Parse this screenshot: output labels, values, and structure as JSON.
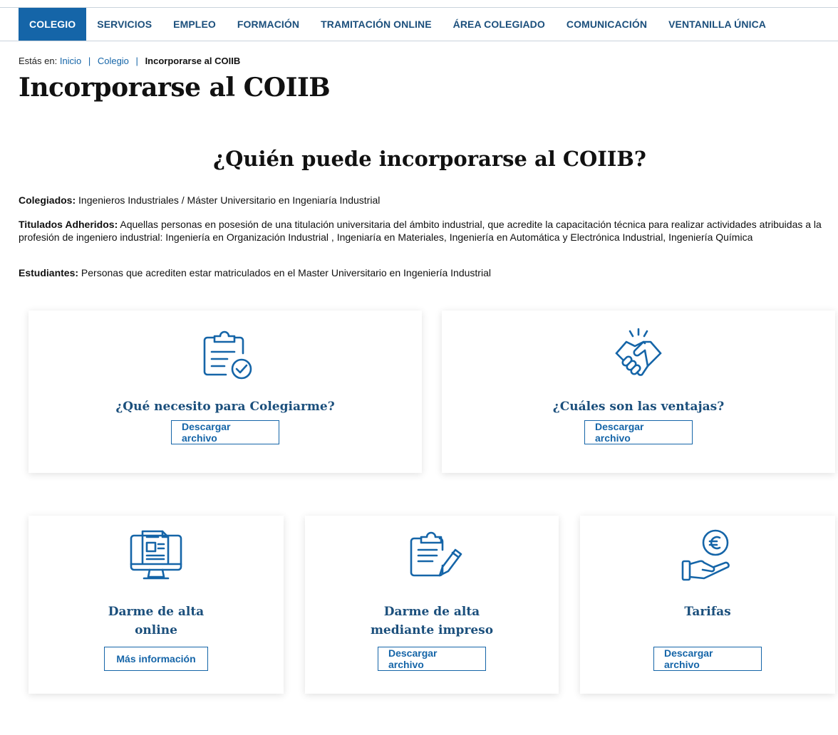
{
  "nav": {
    "items": [
      {
        "label": "COLEGIO"
      },
      {
        "label": "SERVICIOS"
      },
      {
        "label": "EMPLEO"
      },
      {
        "label": "FORMACIÓN"
      },
      {
        "label": "TRAMITACIÓN ONLINE"
      },
      {
        "label": "ÁREA COLEGIADO"
      },
      {
        "label": "COMUNICACIÓN"
      },
      {
        "label": "VENTANILLA ÚNICA"
      }
    ],
    "active": "COLEGIO"
  },
  "breadcrumb": {
    "prefix": "Estás en:",
    "items": [
      "Inicio",
      "Colegio"
    ],
    "separator": "|",
    "current": "Incorporarse al COIIB"
  },
  "page_title": "Incorporarse al COIIB",
  "section_title": "¿Quién puede incorporarse al COIIB?",
  "info": {
    "colegiados_label": "Colegiados:",
    "colegiados_text": " Ingenieros Industriales / Máster Universitario en Ingeniaría Industrial",
    "titulados_label": "Titulados Adheridos:",
    "titulados_text": " Aquellas personas en posesión de una titulación universitaria del ámbito industrial, que acredite la capacitación técnica para realizar actividades atribuidas a la profesión de ingeniero industrial: Ingeniería en Organización Industrial , Ingeniaría en Materiales, Ingeniería en Automática y Electrónica Industrial, Ingeniería Química",
    "estudiantes_label": "Estudiantes:",
    "estudiantes_text": " Personas que acrediten estar matriculados en el Master Universitario en Ingeniería Industrial"
  },
  "cards": [
    {
      "title": "¿Qué necesito para Colegiarme?",
      "button": "Descargar archivo",
      "icon": "clipboard-check-icon"
    },
    {
      "title": "¿Cuáles son las ventajas?",
      "button": "Descargar archivo",
      "icon": "handshake-icon"
    },
    {
      "title_line1": "Darme de alta",
      "title_line2": "online",
      "button": "Más información",
      "icon": "computer-document-icon"
    },
    {
      "title_line1": "Darme de alta",
      "title_line2": "mediante impreso",
      "button": "Descargar archivo",
      "icon": "clipboard-pen-icon"
    },
    {
      "title": "Tarifas",
      "button": "Descargar archivo",
      "icon": "hand-euro-icon"
    }
  ],
  "colors": {
    "primary": "#1565a8",
    "title_blue": "#1b4f7c"
  }
}
